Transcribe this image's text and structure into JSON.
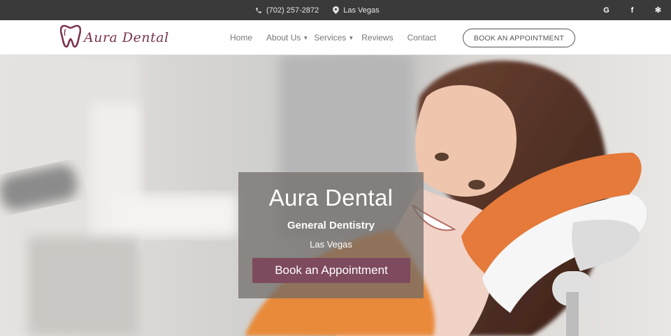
{
  "topbar": {
    "phone": "(702) 257-2872",
    "location": "Las Vegas",
    "social": [
      {
        "icon": "google-icon",
        "glyph": "G"
      },
      {
        "icon": "facebook-icon",
        "glyph": "f"
      },
      {
        "icon": "yelp-icon",
        "glyph": "✻"
      }
    ]
  },
  "brand": {
    "name": "Aura Dental",
    "color": "#7a3350"
  },
  "nav": {
    "items": [
      {
        "label": "Home"
      },
      {
        "label": "About Us"
      },
      {
        "label": "Services"
      },
      {
        "label": "Reviews"
      },
      {
        "label": "Contact"
      }
    ],
    "book_label": "BOOK AN APPOINTMENT"
  },
  "hero": {
    "title": "Aura Dental",
    "subtitle": "General Dentistry",
    "location": "Las Vegas",
    "cta_label": "Book an Appointment",
    "cta_color": "#7e4a5d"
  }
}
